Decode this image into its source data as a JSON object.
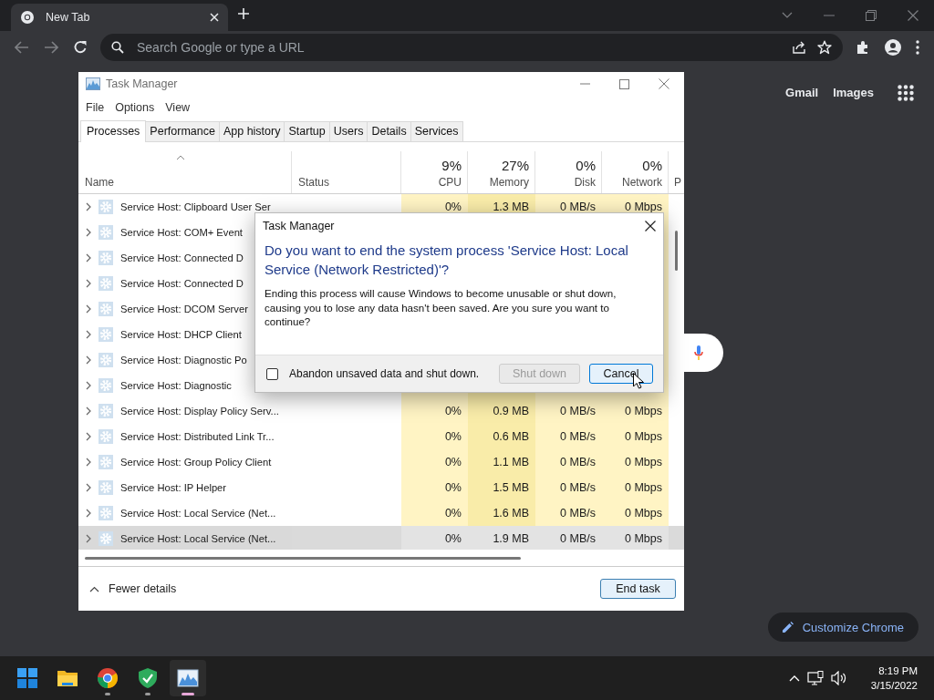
{
  "browser": {
    "tabs": [
      {
        "title": "New Tab",
        "selected": true
      }
    ],
    "omnibox": {
      "placeholder": "Search Google or type a URL"
    }
  },
  "page": {
    "links": [
      "Gmail",
      "Images"
    ],
    "customize_button": "Customize Chrome"
  },
  "task_manager": {
    "title": "Task Manager",
    "menu": [
      "File",
      "Options",
      "View"
    ],
    "tabs": [
      {
        "label": "Processes",
        "selected": true
      },
      {
        "label": "Performance",
        "selected": false
      },
      {
        "label": "App history",
        "selected": false
      },
      {
        "label": "Startup",
        "selected": false
      },
      {
        "label": "Users",
        "selected": false
      },
      {
        "label": "Details",
        "selected": false
      },
      {
        "label": "Services",
        "selected": false
      }
    ],
    "columns": [
      {
        "label": "Name"
      },
      {
        "label": "Status"
      },
      {
        "percent": "9%",
        "label": "CPU"
      },
      {
        "percent": "27%",
        "label": "Memory"
      },
      {
        "percent": "0%",
        "label": "Disk"
      },
      {
        "percent": "0%",
        "label": "Network"
      },
      {
        "label": "P"
      }
    ],
    "rows": [
      {
        "name": "Service Host: Clipboard User Ser",
        "values": [
          "0%",
          "1.3 MB",
          "0 MB/s",
          "0 Mbps"
        ],
        "selected": false
      },
      {
        "name": "Service Host: COM+ Event",
        "selected": false
      },
      {
        "name": "Service Host: Connected D",
        "selected": false
      },
      {
        "name": "Service Host: Connected D",
        "selected": false
      },
      {
        "name": "Service Host: DCOM Server",
        "selected": false
      },
      {
        "name": "Service Host: DHCP Client",
        "selected": false
      },
      {
        "name": "Service Host: Diagnostic Po",
        "selected": false
      },
      {
        "name": "Service Host: Diagnostic",
        "selected": false
      },
      {
        "name": "Service Host: Display Policy Serv...",
        "values": [
          "0%",
          "0.9 MB",
          "0 MB/s",
          "0 Mbps"
        ],
        "selected": false
      },
      {
        "name": "Service Host: Distributed Link Tr...",
        "values": [
          "0%",
          "0.6 MB",
          "0 MB/s",
          "0 Mbps"
        ],
        "selected": false
      },
      {
        "name": "Service Host: Group Policy Client",
        "values": [
          "0%",
          "1.1 MB",
          "0 MB/s",
          "0 Mbps"
        ],
        "selected": false
      },
      {
        "name": "Service Host: IP Helper",
        "values": [
          "0%",
          "1.5 MB",
          "0 MB/s",
          "0 Mbps"
        ],
        "selected": false
      },
      {
        "name": "Service Host: Local Service (Net...",
        "values": [
          "0%",
          "1.6 MB",
          "0 MB/s",
          "0 Mbps"
        ],
        "selected": false
      },
      {
        "name": "Service Host: Local Service (Net...",
        "values": [
          "0%",
          "1.9 MB",
          "0 MB/s",
          "0 Mbps"
        ],
        "selected": true
      }
    ],
    "footer": {
      "toggle": "Fewer details",
      "button": "End task"
    }
  },
  "dialog": {
    "title": "Task Manager",
    "heading": "Do you want to end the system process 'Service Host: Local Service (Network Restricted)'?",
    "message": "Ending this process will cause Windows to become unusable or shut down, causing you to lose any data hasn't been saved. Are you sure you want to continue?",
    "checkbox": {
      "label": "Abandon unsaved data and shut down.",
      "checked": false
    },
    "buttons": [
      {
        "label": "Shut down",
        "disabled": true,
        "focused": false
      },
      {
        "label": "Cancel",
        "disabled": false,
        "focused": true
      }
    ]
  },
  "taskbar": {
    "apps": [
      {
        "kind": "start",
        "running": false,
        "selected": false
      },
      {
        "kind": "explorer",
        "running": false,
        "selected": false
      },
      {
        "kind": "chrome",
        "running": true,
        "selected": false
      },
      {
        "kind": "shield",
        "running": true,
        "selected": false
      },
      {
        "kind": "taskmanager",
        "running": true,
        "selected": true
      }
    ],
    "clock": {
      "time": "8:19 PM",
      "date": "3/15/2022"
    }
  }
}
